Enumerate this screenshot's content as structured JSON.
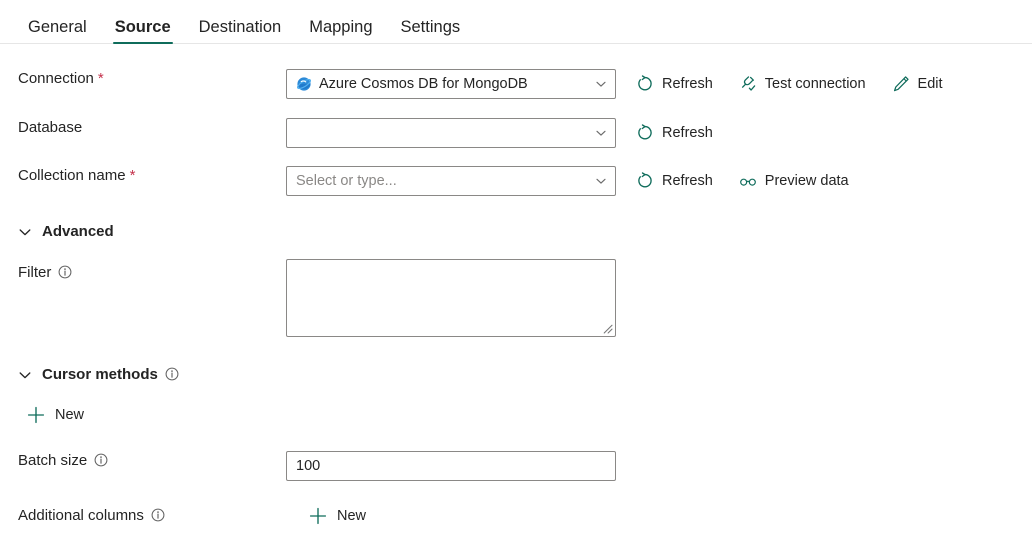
{
  "tabs": [
    {
      "label": "General",
      "active": false
    },
    {
      "label": "Source",
      "active": true
    },
    {
      "label": "Destination",
      "active": false
    },
    {
      "label": "Mapping",
      "active": false
    },
    {
      "label": "Settings",
      "active": false
    }
  ],
  "colors": {
    "accent_teal": "#0f6c5b",
    "tab_underline": "#0f6c5b",
    "required_asterisk": "#c4314b",
    "text": "#242424",
    "placeholder": "#8a8886",
    "border": "#8a8886",
    "divider": "#e6e6e6",
    "cosmos_icon_blue": "#2c8ad8",
    "info_icon": "#616161"
  },
  "form": {
    "connection": {
      "label": "Connection",
      "required": true,
      "value": "Azure Cosmos DB for MongoDB",
      "icon": "azure-cosmos-db-icon",
      "commands": [
        {
          "label": "Refresh",
          "icon": "refresh-icon"
        },
        {
          "label": "Test connection",
          "icon": "plug-check-icon"
        },
        {
          "label": "Edit",
          "icon": "pencil-icon"
        }
      ]
    },
    "database": {
      "label": "Database",
      "required": false,
      "value": "",
      "placeholder": "",
      "commands": [
        {
          "label": "Refresh",
          "icon": "refresh-icon"
        }
      ]
    },
    "collection_name": {
      "label": "Collection name",
      "required": true,
      "value": "",
      "placeholder": "Select or type...",
      "commands": [
        {
          "label": "Refresh",
          "icon": "refresh-icon"
        },
        {
          "label": "Preview data",
          "icon": "glasses-icon"
        }
      ]
    },
    "advanced_section": {
      "label": "Advanced",
      "expanded": true
    },
    "filter": {
      "label": "Filter",
      "info": true,
      "value": "",
      "placeholder": ""
    },
    "cursor_methods_section": {
      "label": "Cursor methods",
      "info": true,
      "expanded": true,
      "new_button": {
        "label": "New",
        "icon": "plus-icon"
      }
    },
    "batch_size": {
      "label": "Batch size",
      "info": true,
      "value": "100",
      "placeholder": ""
    },
    "additional_columns": {
      "label": "Additional columns",
      "info": true,
      "new_button": {
        "label": "New",
        "icon": "plus-icon"
      }
    }
  }
}
